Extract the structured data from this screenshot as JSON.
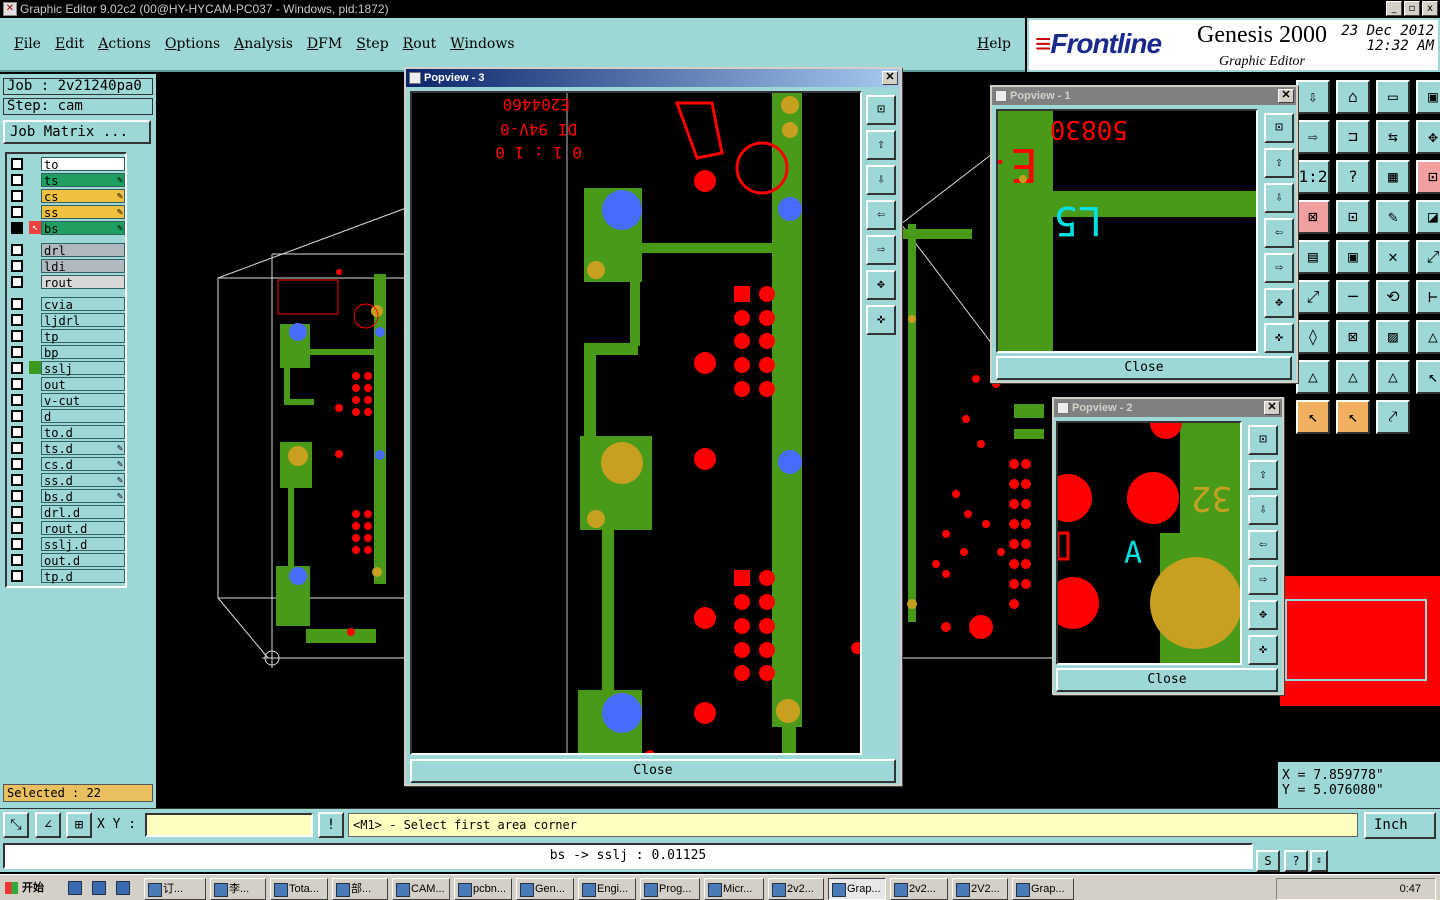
{
  "window": {
    "title": "Graphic Editor 9.02c2 (00@HY-HYCAM-PC037 - Windows, pid:1872)",
    "buttons": [
      "_",
      "▫",
      "x"
    ]
  },
  "menu": {
    "items": [
      "File",
      "Edit",
      "Actions",
      "Options",
      "Analysis",
      "DFM",
      "Step",
      "Rout",
      "Windows"
    ],
    "help": "Help"
  },
  "brand": {
    "logo": "Frontline",
    "product": "Genesis 2000",
    "subtitle": "Graphic Editor",
    "date": "23 Dec 2012",
    "time": "12:32 AM"
  },
  "job": {
    "job": "Job : 2v21240pa0",
    "step": "Step: cam",
    "matrix_button": "Job Matrix ..."
  },
  "layers": [
    {
      "name": "to",
      "color": "#ffffff",
      "on": false,
      "edit": false
    },
    {
      "name": "ts",
      "color": "#20a060",
      "on": false,
      "edit": true
    },
    {
      "name": "cs",
      "color": "#f0c040",
      "on": false,
      "edit": true
    },
    {
      "name": "ss",
      "color": "#f0c040",
      "on": false,
      "edit": true
    },
    {
      "name": "bs",
      "color": "#20a060",
      "on": true,
      "edit": true
    },
    {
      "name": "drl",
      "color": "#b0b8c0",
      "on": false,
      "edit": false
    },
    {
      "name": "ldi",
      "color": "#b0b8c0",
      "on": false,
      "edit": false
    },
    {
      "name": "rout",
      "color": "#d8d8d8",
      "on": false,
      "edit": false
    },
    {
      "name": "cvia",
      "color": "#9ed8d6",
      "on": false,
      "edit": false
    },
    {
      "name": "ljdrl",
      "color": "#9ed8d6",
      "on": false,
      "edit": false
    },
    {
      "name": "tp",
      "color": "#9ed8d6",
      "on": false,
      "edit": false
    },
    {
      "name": "bp",
      "color": "#9ed8d6",
      "on": false,
      "edit": false
    },
    {
      "name": "sslj",
      "color": "#9ed8d6",
      "on": false,
      "edit": false,
      "mark": "#3a9a20"
    },
    {
      "name": "out",
      "color": "#9ed8d6",
      "on": false,
      "edit": false
    },
    {
      "name": "v-cut",
      "color": "#9ed8d6",
      "on": false,
      "edit": false
    },
    {
      "name": "d",
      "color": "#9ed8d6",
      "on": false,
      "edit": false
    },
    {
      "name": "to.d",
      "color": "#9ed8d6",
      "on": false,
      "edit": false
    },
    {
      "name": "ts.d",
      "color": "#9ed8d6",
      "on": false,
      "edit": true
    },
    {
      "name": "cs.d",
      "color": "#9ed8d6",
      "on": false,
      "edit": true
    },
    {
      "name": "ss.d",
      "color": "#9ed8d6",
      "on": false,
      "edit": true
    },
    {
      "name": "bs.d",
      "color": "#9ed8d6",
      "on": false,
      "edit": true
    },
    {
      "name": "drl.d",
      "color": "#9ed8d6",
      "on": false,
      "edit": false
    },
    {
      "name": "rout.d",
      "color": "#9ed8d6",
      "on": false,
      "edit": false
    },
    {
      "name": "sslj.d",
      "color": "#9ed8d6",
      "on": false,
      "edit": false
    },
    {
      "name": "out.d",
      "color": "#9ed8d6",
      "on": false,
      "edit": false
    },
    {
      "name": "tp.d",
      "color": "#9ed8d6",
      "on": false,
      "edit": false
    }
  ],
  "selected": "Selected : 22",
  "popups": {
    "p3": {
      "title": "Popview - 3",
      "close": "Close",
      "texts": [
        "E204460",
        "DI 94V-0",
        "0 1 : 1 0"
      ]
    },
    "p1": {
      "title": "Popview - 1",
      "close": "Close",
      "texts": [
        "E-503",
        "L5"
      ]
    },
    "p2": {
      "title": "Popview - 2",
      "close": "Close",
      "texts": [
        "32",
        "A"
      ]
    }
  },
  "command": {
    "xy_label": "X Y :",
    "xy_value": "",
    "prompt": "<M1> - Select first area corner",
    "units": "Inch"
  },
  "coords": {
    "x": "X = 7.859778\"",
    "y": "Y = 5.076080\""
  },
  "status": "bs -> sslj : 0.01125",
  "taskbar": {
    "start": "开始",
    "items": [
      "订...",
      "李...",
      "Tota...",
      "部...",
      "CAM...",
      "pcbn...",
      "Gen...",
      "Engi...",
      "Prog...",
      "Micr...",
      "2v2...",
      "Grap...",
      "2v2...",
      "2V2...",
      "Grap..."
    ],
    "active_index": 11,
    "clock": "0:47"
  },
  "colors": {
    "panel": "#9ed8d6",
    "copper": "#4a9a1a",
    "pad": "#ff0000",
    "via": "#4a6cff",
    "gold": "#c8a020",
    "highlight": "#ffffc0"
  }
}
